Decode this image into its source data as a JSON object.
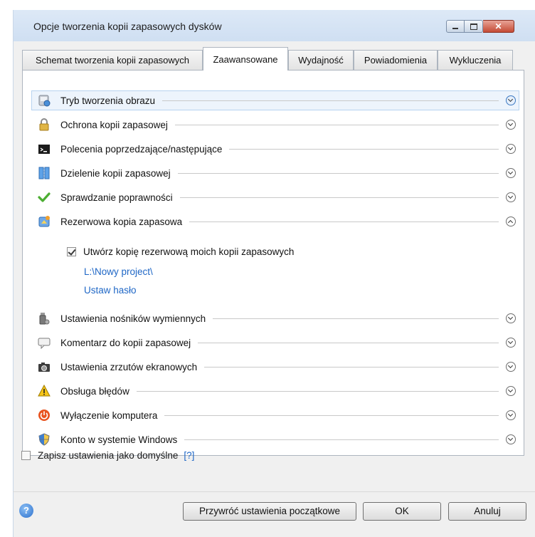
{
  "window": {
    "title": "Opcje tworzenia kopii zapasowych dysków"
  },
  "tabs": [
    {
      "label": "Schemat tworzenia kopii zapasowych"
    },
    {
      "label": "Zaawansowane"
    },
    {
      "label": "Wydajność"
    },
    {
      "label": "Powiadomienia"
    },
    {
      "label": "Wykluczenia"
    }
  ],
  "sections": [
    {
      "label": "Tryb tworzenia obrazu",
      "icon": "disk-image-icon",
      "state": "collapsed"
    },
    {
      "label": "Ochrona kopii zapasowej",
      "icon": "lock-icon",
      "state": "collapsed"
    },
    {
      "label": "Polecenia poprzedzające/następujące",
      "icon": "command-prompt-icon",
      "state": "collapsed"
    },
    {
      "label": "Dzielenie kopii zapasowej",
      "icon": "split-file-icon",
      "state": "collapsed"
    },
    {
      "label": "Sprawdzanie poprawności",
      "icon": "checkmark-icon",
      "state": "collapsed"
    },
    {
      "label": "Rezerwowa kopia zapasowa",
      "icon": "reserve-backup-icon",
      "state": "expanded"
    },
    {
      "label": "Ustawienia nośników wymiennych",
      "icon": "usb-drive-icon",
      "state": "collapsed"
    },
    {
      "label": "Komentarz do kopii zapasowej",
      "icon": "comment-icon",
      "state": "collapsed"
    },
    {
      "label": "Ustawienia zrzutów ekranowych",
      "icon": "camera-icon",
      "state": "collapsed"
    },
    {
      "label": "Obsługa błędów",
      "icon": "warning-icon",
      "state": "collapsed"
    },
    {
      "label": "Wyłączenie komputera",
      "icon": "power-icon",
      "state": "collapsed"
    },
    {
      "label": "Konto w systemie Windows",
      "icon": "shield-icon",
      "state": "collapsed"
    }
  ],
  "reserve": {
    "checkbox_label": "Utwórz kopię rezerwową moich kopii zapasowych",
    "checked": true,
    "path": "L:\\Nowy project\\",
    "password_link": "Ustaw hasło"
  },
  "default_option": {
    "label": "Zapisz ustawienia jako domyślne",
    "help": "[?]",
    "checked": false
  },
  "buttons": {
    "reset": "Przywróć ustawienia początkowe",
    "ok": "OK",
    "cancel": "Anuluj"
  },
  "colors": {
    "link": "#1f67c6",
    "selected_row": "#edf4fc",
    "close_button": "#c44b35"
  }
}
